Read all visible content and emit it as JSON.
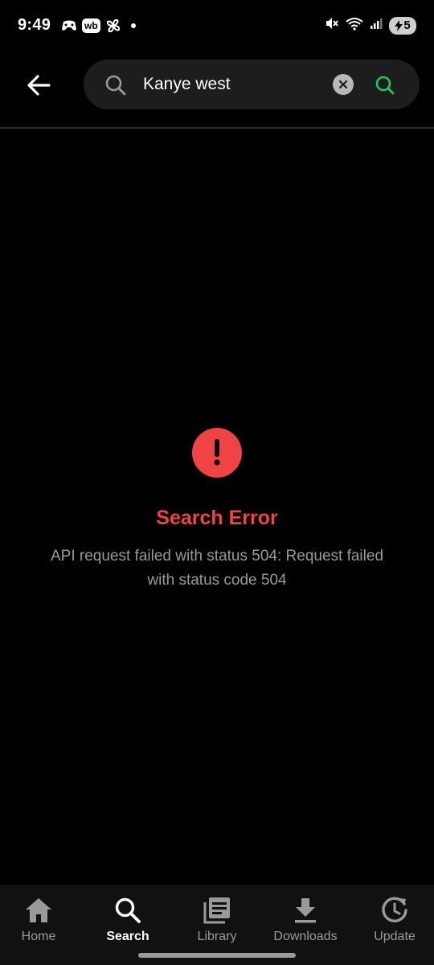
{
  "status_bar": {
    "time": "9:49",
    "notification_badge": "wb",
    "battery_level": "5"
  },
  "header": {
    "search": {
      "value": "Kanye west",
      "placeholder": ""
    }
  },
  "error": {
    "title": "Search Error",
    "message": "API request failed with status 504: Request failed with status code 504"
  },
  "bottom_nav": {
    "items": [
      {
        "label": "Home",
        "icon": "home-icon",
        "active": false
      },
      {
        "label": "Search",
        "icon": "search-icon",
        "active": true
      },
      {
        "label": "Library",
        "icon": "library-icon",
        "active": false
      },
      {
        "label": "Downloads",
        "icon": "download-icon",
        "active": false
      },
      {
        "label": "Update",
        "icon": "update-icon",
        "active": false
      }
    ]
  },
  "colors": {
    "background": "#000000",
    "error": "#ef4444",
    "accent_search": "#22c55e",
    "search_box": "#1d1d1d",
    "muted_text": "#9a9a9a"
  }
}
